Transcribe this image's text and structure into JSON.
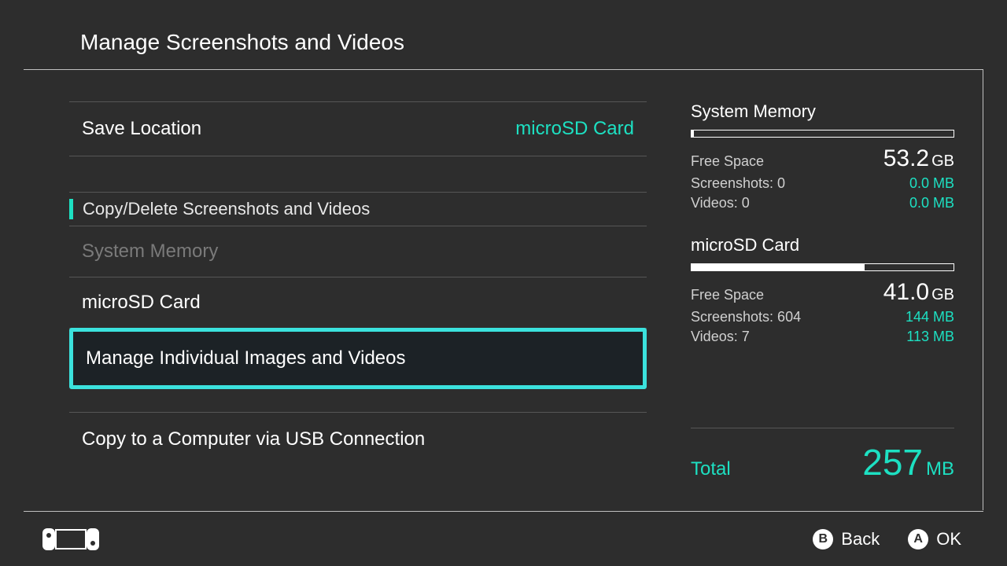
{
  "header": {
    "title": "Manage Screenshots and Videos"
  },
  "left": {
    "saveLocation": {
      "label": "Save Location",
      "value": "microSD Card"
    },
    "copyDeleteHeader": "Copy/Delete Screenshots and Videos",
    "systemMemory": "System Memory",
    "microSD": "microSD Card",
    "manageIndividual": "Manage Individual Images and Videos",
    "copyToComputer": "Copy to a Computer via USB Connection"
  },
  "right": {
    "systemMemory": {
      "title": "System Memory",
      "fillPercent": 1,
      "freeLabel": "Free Space",
      "freeValue": "53.2",
      "freeUnit": "GB",
      "screenshots": {
        "label": "Screenshots: 0",
        "value": "0.0 MB"
      },
      "videos": {
        "label": "Videos: 0",
        "value": "0.0 MB"
      }
    },
    "microSD": {
      "title": "microSD Card",
      "fillPercent": 66,
      "freeLabel": "Free Space",
      "freeValue": "41.0",
      "freeUnit": "GB",
      "screenshots": {
        "label": "Screenshots: 604",
        "value": "144 MB"
      },
      "videos": {
        "label": "Videos: 7",
        "value": "113 MB"
      }
    },
    "total": {
      "label": "Total",
      "value": "257",
      "unit": "MB"
    }
  },
  "footer": {
    "back": {
      "key": "B",
      "label": "Back"
    },
    "ok": {
      "key": "A",
      "label": "OK"
    }
  }
}
